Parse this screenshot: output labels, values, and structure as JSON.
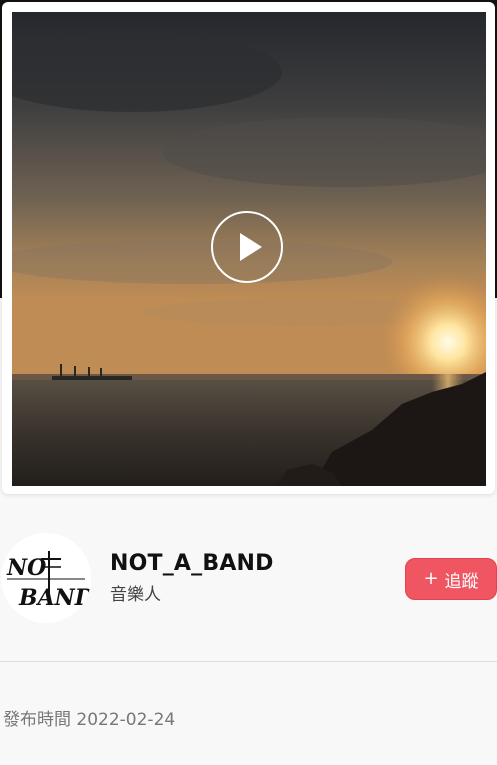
{
  "video": {
    "thumbnail": "sunset-over-harbor",
    "play_icon": "play-icon"
  },
  "artist": {
    "name": "NOT_A_BAND",
    "role": "音樂人",
    "avatar_logo_text": "NOT A BAND"
  },
  "follow": {
    "icon": "+",
    "label": "追蹤"
  },
  "publish": {
    "label": "發布時間",
    "date": "2022-02-24"
  },
  "colors": {
    "follow_button": "#f05562",
    "page_background": "#f8f8f8"
  }
}
